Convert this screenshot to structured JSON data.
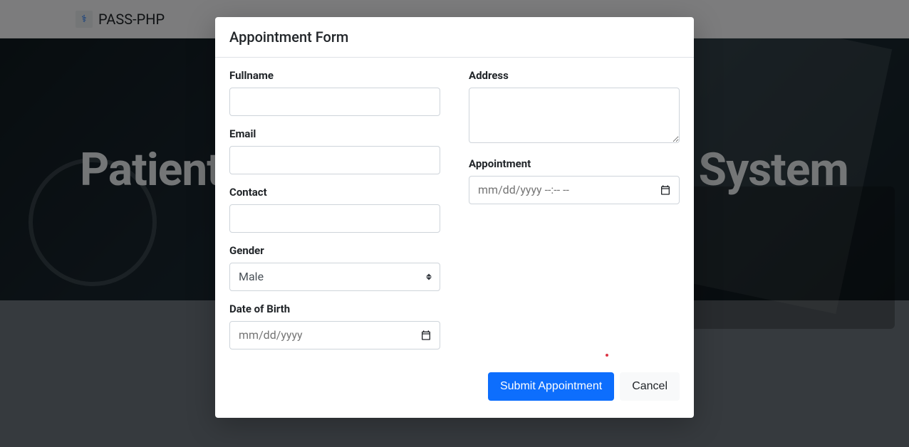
{
  "brand": {
    "name": "PASS-PHP"
  },
  "hero": {
    "title_left": "Patient",
    "title_right": "System"
  },
  "modal": {
    "title": "Appointment Form",
    "fields": {
      "fullname_label": "Fullname",
      "email_label": "Email",
      "contact_label": "Contact",
      "gender_label": "Gender",
      "gender_value": "Male",
      "dob_label": "Date of Birth",
      "dob_placeholder": "mm/dd/yyyy",
      "address_label": "Address",
      "appointment_label": "Appointment",
      "appointment_placeholder": "mm/dd/yyyy --:-- --"
    },
    "actions": {
      "submit": "Submit Appointment",
      "cancel": "Cancel"
    }
  }
}
